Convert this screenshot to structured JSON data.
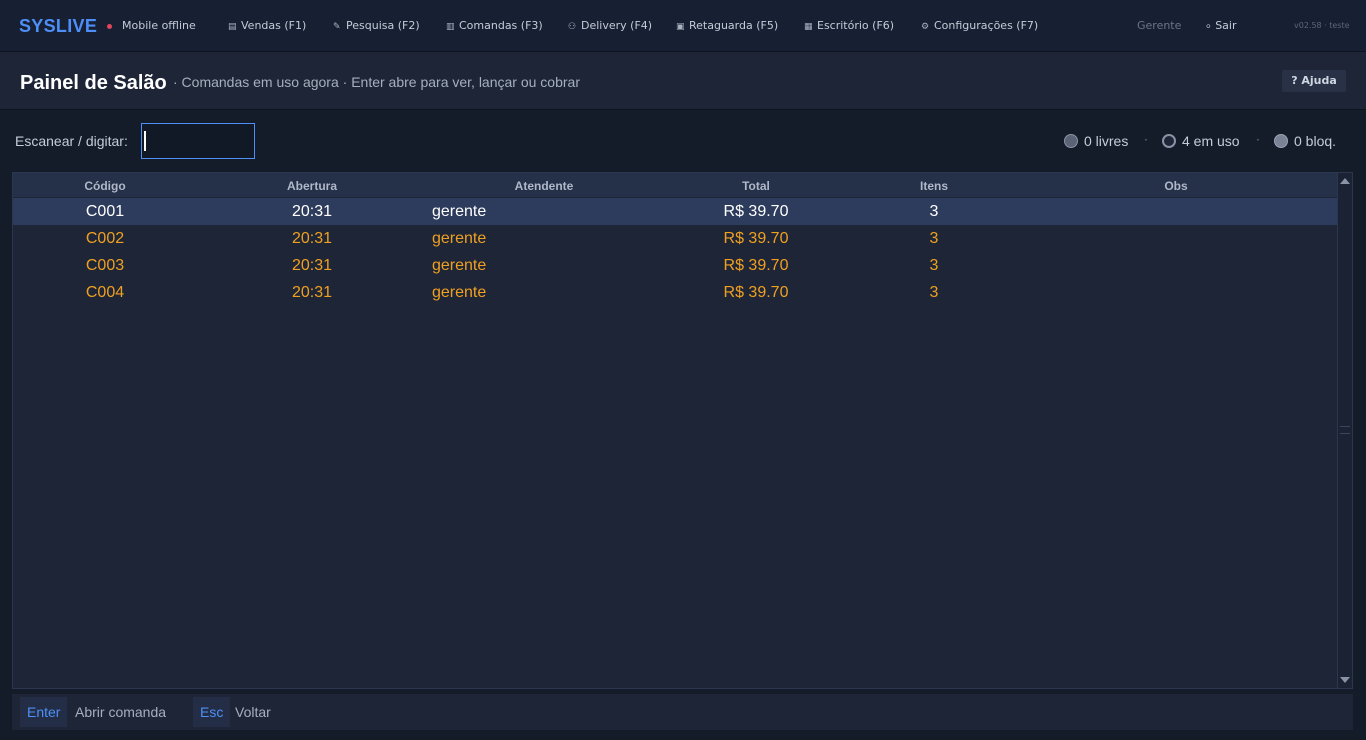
{
  "app": {
    "brand": "SYSLIVE",
    "status": "Mobile offline",
    "user": "Gerente",
    "logout": "Sair",
    "version": "v02.58 · teste",
    "colors": {
      "accent": "#4e8ef7",
      "status_offline": "#e0455c",
      "in_use": "#f0a020"
    }
  },
  "nav": [
    {
      "label": "Vendas (F1)",
      "icon": "register-icon"
    },
    {
      "label": "Pesquisa (F2)",
      "icon": "search-icon"
    },
    {
      "label": "Comandas (F3)",
      "icon": "clipboard-icon"
    },
    {
      "label": "Delivery (F4)",
      "icon": "bike-icon"
    },
    {
      "label": "Retaguarda (F5)",
      "icon": "box-icon"
    },
    {
      "label": "Escritório (F6)",
      "icon": "building-icon"
    },
    {
      "label": "Configurações (F7)",
      "icon": "gear-icon"
    }
  ],
  "header": {
    "title": "Painel de Salão",
    "subtitle": "· Comandas em uso agora · Enter abre para ver, lançar ou cobrar",
    "help": "? Ajuda"
  },
  "scan": {
    "label": "Escanear / digitar:",
    "value": ""
  },
  "legend": [
    {
      "label": "0 livres"
    },
    {
      "label": "4 em uso"
    },
    {
      "label": "0 bloq."
    }
  ],
  "table": {
    "columns": [
      "Código",
      "Abertura",
      "Atendente",
      "Total",
      "Itens",
      "Obs"
    ],
    "rows": [
      {
        "code": "C001",
        "opened": "20:31",
        "attendant": "gerente",
        "total": "R$ 39.70",
        "items": "3",
        "obs": "",
        "selected": true
      },
      {
        "code": "C002",
        "opened": "20:31",
        "attendant": "gerente",
        "total": "R$ 39.70",
        "items": "3",
        "obs": "",
        "selected": false
      },
      {
        "code": "C003",
        "opened": "20:31",
        "attendant": "gerente",
        "total": "R$ 39.70",
        "items": "3",
        "obs": "",
        "selected": false
      },
      {
        "code": "C004",
        "opened": "20:31",
        "attendant": "gerente",
        "total": "R$ 39.70",
        "items": "3",
        "obs": "",
        "selected": false
      }
    ]
  },
  "footer": {
    "shortcuts": [
      {
        "key": "Enter",
        "label": "Abrir comanda"
      },
      {
        "key": "Esc",
        "label": "Voltar"
      }
    ]
  }
}
